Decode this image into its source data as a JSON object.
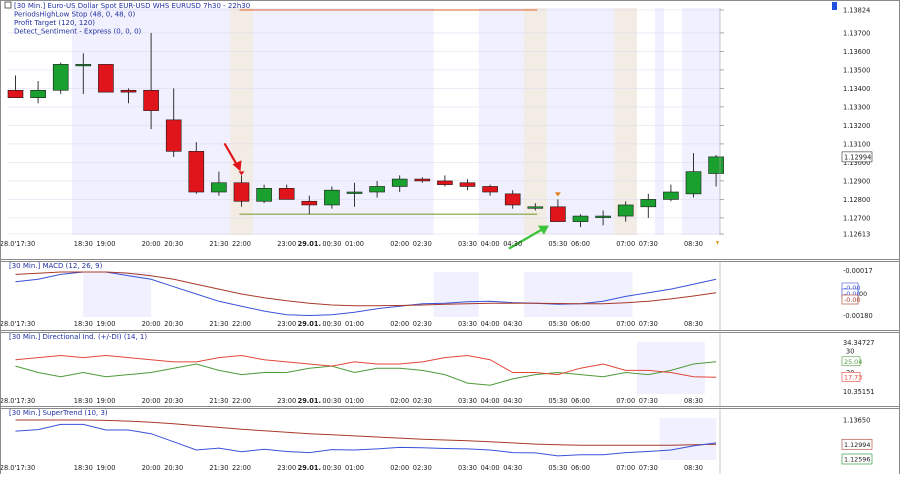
{
  "colors": {
    "bull": "#1aa02f",
    "bear": "#e0151b",
    "wick": "#202020",
    "plot_bg": "#f0f0ff",
    "band_white": "#ffffff",
    "band_peach": "#f2ece4",
    "macd_line": "#3a52d8",
    "signal_line": "#a83a2a",
    "di_plus": "#4f9a3a",
    "di_minus": "#e2473a",
    "supertrend_up": "#3a52d8",
    "supertrend_down": "#a83a2a",
    "stop_line": "#e08050",
    "target_line": "#80a040"
  },
  "time_axis": {
    "labels": [
      "28.0'17:30",
      "18:30",
      "19:00",
      "20:00",
      "20:30",
      "21:30",
      "22:00",
      "23:00",
      "29.01.",
      "00:30",
      "01:00",
      "02:00",
      "02:30",
      "03:30",
      "04:00",
      "04:30",
      "05:30",
      "06:00",
      "07:00",
      "07:30",
      "08:30"
    ],
    "bold": [
      "29.01."
    ]
  },
  "panels": {
    "price": {
      "header_lines": [
        "[30 Min.] Euro-US Dollar Spot   EUR-USD WHS EURUSD 7h30 - 22h30",
        "PeriodsHighLow Stop  (48, 0, 48, 0)",
        "Profit Target  (120, 120)",
        "Detect_Sentiment - Express  (0, 0, 0)"
      ],
      "axis_labels": [
        "1.13824",
        "1.13700",
        "1.13600",
        "1.13500",
        "1.13400",
        "1.13300",
        "1.13200",
        "1.13100",
        "1.13000",
        "1.12900",
        "1.12800",
        "1.12700",
        "1.12613"
      ],
      "price_tag": "1.12994",
      "stop_level": "1.13824",
      "target_level": "1.12720"
    },
    "macd": {
      "title": "[30 Min.] MACD  (12, 26, 9)",
      "axis_labels": [
        "-0.00017",
        "-0.00180"
      ],
      "tags": [
        "-0.00",
        "-0.00",
        "-0.00"
      ],
      "tag_suffix": "00"
    },
    "dmi": {
      "title": "[30 Min.] Directional Ind.  (+/-DI)  (14, 1)",
      "axis_labels": [
        "34.34727",
        "30",
        "20",
        "10.35151"
      ],
      "tags": [
        "25.04",
        "17.73"
      ]
    },
    "supertrend": {
      "title": "[30 Min.] SuperTrend  (10, 3)",
      "axis_labels": [
        "1.13650"
      ],
      "tags": [
        "1.12994",
        "1.12596"
      ]
    }
  },
  "chart_data": [
    {
      "type": "candlestick",
      "title": "[30 Min.] Euro-US Dollar Spot   EUR-USD WHS EURUSD 7h30 - 22h30",
      "ylim": [
        1.12613,
        1.13824
      ],
      "candles": [
        {
          "o": 1.1339,
          "h": 1.1347,
          "l": 1.1335,
          "c": 1.1335
        },
        {
          "o": 1.1335,
          "h": 1.1344,
          "l": 1.1332,
          "c": 1.1339
        },
        {
          "o": 1.1339,
          "h": 1.1354,
          "l": 1.1337,
          "c": 1.1353
        },
        {
          "o": 1.1353,
          "h": 1.1359,
          "l": 1.1337,
          "c": 1.1353
        },
        {
          "o": 1.1353,
          "h": 1.1353,
          "l": 1.1338,
          "c": 1.1338
        },
        {
          "o": 1.1339,
          "h": 1.134,
          "l": 1.1332,
          "c": 1.1338
        },
        {
          "o": 1.1339,
          "h": 1.137,
          "l": 1.1318,
          "c": 1.1328
        },
        {
          "o": 1.1323,
          "h": 1.134,
          "l": 1.1303,
          "c": 1.1306
        },
        {
          "o": 1.1306,
          "h": 1.1311,
          "l": 1.1283,
          "c": 1.1284
        },
        {
          "o": 1.1284,
          "h": 1.1295,
          "l": 1.1282,
          "c": 1.1289
        },
        {
          "o": 1.1289,
          "h": 1.1293,
          "l": 1.1276,
          "c": 1.1279
        },
        {
          "o": 1.1279,
          "h": 1.1288,
          "l": 1.1278,
          "c": 1.1286
        },
        {
          "o": 1.1286,
          "h": 1.1288,
          "l": 1.128,
          "c": 1.128
        },
        {
          "o": 1.1279,
          "h": 1.1282,
          "l": 1.1272,
          "c": 1.1277
        },
        {
          "o": 1.1277,
          "h": 1.1287,
          "l": 1.1275,
          "c": 1.1285
        },
        {
          "o": 1.1284,
          "h": 1.1289,
          "l": 1.1276,
          "c": 1.1284
        },
        {
          "o": 1.1284,
          "h": 1.129,
          "l": 1.1281,
          "c": 1.1287
        },
        {
          "o": 1.1287,
          "h": 1.1293,
          "l": 1.1284,
          "c": 1.1291
        },
        {
          "o": 1.1291,
          "h": 1.1292,
          "l": 1.1289,
          "c": 1.129
        },
        {
          "o": 1.129,
          "h": 1.1293,
          "l": 1.1287,
          "c": 1.1288
        },
        {
          "o": 1.1289,
          "h": 1.1291,
          "l": 1.1285,
          "c": 1.1287
        },
        {
          "o": 1.1287,
          "h": 1.1288,
          "l": 1.1282,
          "c": 1.1284
        },
        {
          "o": 1.1283,
          "h": 1.1285,
          "l": 1.1275,
          "c": 1.1277
        },
        {
          "o": 1.1276,
          "h": 1.1278,
          "l": 1.1274,
          "c": 1.1276
        },
        {
          "o": 1.1276,
          "h": 1.128,
          "l": 1.1268,
          "c": 1.1268
        },
        {
          "o": 1.1268,
          "h": 1.1272,
          "l": 1.1265,
          "c": 1.1271
        },
        {
          "o": 1.1271,
          "h": 1.1274,
          "l": 1.1266,
          "c": 1.1271
        },
        {
          "o": 1.1271,
          "h": 1.1279,
          "l": 1.1268,
          "c": 1.1277
        },
        {
          "o": 1.1276,
          "h": 1.1283,
          "l": 1.127,
          "c": 1.128
        },
        {
          "o": 1.128,
          "h": 1.1288,
          "l": 1.1279,
          "c": 1.1284
        },
        {
          "o": 1.1283,
          "h": 1.1305,
          "l": 1.1281,
          "c": 1.1295
        },
        {
          "o": 1.1294,
          "h": 1.1304,
          "l": 1.1287,
          "c": 1.1303
        }
      ],
      "stop_line": {
        "value": 1.13824,
        "from_index": 10,
        "to_index": 23
      },
      "target_line": {
        "value": 1.1272,
        "from_index": 10,
        "to_index": 23
      },
      "signals": [
        {
          "type": "sell-arrow",
          "index": 10,
          "color": "#e0151b"
        },
        {
          "type": "buy-arrow",
          "index": 24,
          "color": "#3cc43c"
        },
        {
          "type": "marker",
          "index": 24,
          "color": "#e07a1a"
        }
      ]
    },
    {
      "type": "line",
      "title": "[30 Min.] MACD  (12, 26, 9)",
      "ylim": [
        -0.0018,
        0.0
      ],
      "series": [
        {
          "name": "MACD",
          "color": "#3a52d8",
          "values": [
            -0.0004,
            -0.0003,
            -0.0001,
            0.0,
            0.0,
            -0.00015,
            -0.0003,
            -0.0006,
            -0.0009,
            -0.0012,
            -0.0014,
            -0.0016,
            -0.00175,
            -0.00178,
            -0.00175,
            -0.00165,
            -0.0015,
            -0.0014,
            -0.0013,
            -0.00128,
            -0.00122,
            -0.0012,
            -0.00125,
            -0.00128,
            -0.00132,
            -0.0013,
            -0.0012,
            -0.001,
            -0.00085,
            -0.0007,
            -0.0005,
            -0.0003
          ]
        },
        {
          "name": "Signal",
          "color": "#a83a2a",
          "values": [
            -0.0001,
            -5e-05,
            0.0,
            0.0,
            0.0,
            -5e-05,
            -0.00015,
            -0.0003,
            -0.0005,
            -0.0007,
            -0.0009,
            -0.00105,
            -0.00118,
            -0.00128,
            -0.00135,
            -0.00138,
            -0.00138,
            -0.00137,
            -0.00135,
            -0.00132,
            -0.0013,
            -0.00128,
            -0.00128,
            -0.00128,
            -0.00129,
            -0.0013,
            -0.0013,
            -0.00126,
            -0.0012,
            -0.0011,
            -0.00098,
            -0.00085
          ]
        }
      ]
    },
    {
      "type": "line",
      "title": "[30 Min.] Directional Ind.  (+/-DI)  (14, 1)",
      "ylim": [
        10.35151,
        34.34727
      ],
      "series": [
        {
          "name": "+DI",
          "color": "#4f9a3a",
          "values": [
            23,
            20,
            18,
            20,
            18,
            19,
            20,
            22,
            24,
            21,
            19,
            20,
            20,
            22,
            23,
            20,
            22,
            22,
            21,
            19,
            15,
            14,
            17,
            19,
            20,
            19,
            18,
            20,
            19,
            21,
            24,
            25.04
          ]
        },
        {
          "name": "-DI",
          "color": "#e2473a",
          "values": [
            26,
            27,
            28,
            27,
            28,
            27,
            26,
            25,
            25,
            27,
            28,
            26,
            25,
            24,
            23,
            25,
            24,
            24,
            25,
            27,
            28,
            26,
            20,
            20,
            19,
            22,
            24,
            21,
            21,
            20,
            18,
            17.73
          ]
        }
      ]
    },
    {
      "type": "line",
      "title": "[30 Min.] SuperTrend  (10, 3)",
      "ylim": [
        1.12596,
        1.1365
      ],
      "series": [
        {
          "name": "SuperTrend",
          "color": "#a83a2a",
          "values": [
            1.1365,
            1.1365,
            1.1365,
            1.1365,
            1.1364,
            1.1362,
            1.1359,
            1.1355,
            1.135,
            1.1345,
            1.134,
            1.1336,
            1.1332,
            1.1328,
            1.1325,
            1.1322,
            1.1319,
            1.1316,
            1.1313,
            1.1311,
            1.1309,
            1.1306,
            1.1303,
            1.13,
            1.1298,
            1.1297,
            1.1297,
            1.1297,
            1.1297,
            1.1297,
            1.1298,
            1.12994
          ]
        },
        {
          "name": "Price",
          "color": "#3a52d8",
          "values": [
            1.1335,
            1.1339,
            1.1353,
            1.1353,
            1.1338,
            1.1338,
            1.1328,
            1.1306,
            1.1284,
            1.1289,
            1.1279,
            1.1286,
            1.128,
            1.1277,
            1.1285,
            1.1284,
            1.1287,
            1.1291,
            1.129,
            1.1288,
            1.1287,
            1.1284,
            1.1277,
            1.1276,
            1.1268,
            1.1271,
            1.1271,
            1.1277,
            1.128,
            1.1284,
            1.1295,
            1.1303
          ]
        }
      ]
    }
  ]
}
